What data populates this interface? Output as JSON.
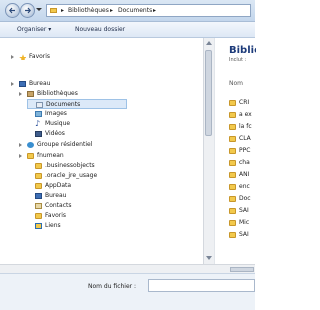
{
  "address": {
    "crumbs": [
      "Bibliothèques",
      "Documents"
    ]
  },
  "toolbar": {
    "organize": "Organiser ▾",
    "new_folder": "Nouveau dossier"
  },
  "nav": {
    "favorites": "Favoris",
    "desktop": "Bureau",
    "libraries": "Bibliothèques",
    "library_items": [
      "Documents",
      "Images",
      "Musique",
      "Vidéos"
    ],
    "homegroup": "Groupe résidentiel",
    "user": "fnumean",
    "user_items": [
      ".businessobjects",
      ".oracle_jre_usage",
      "AppData",
      "Bureau",
      "Contacts",
      "Favoris",
      "Liens"
    ]
  },
  "content": {
    "title": "Biblio",
    "subtitle": "Inclut :",
    "column": "Nom",
    "files": [
      "CRI",
      "a ex",
      "la fc",
      "CLA",
      "PPC",
      "cha",
      "ANI",
      "enc",
      "Doc",
      "SAI",
      "Mic",
      "SAI"
    ]
  },
  "footer": {
    "filename_label": "Nom du fichier :",
    "filename_value": ""
  }
}
